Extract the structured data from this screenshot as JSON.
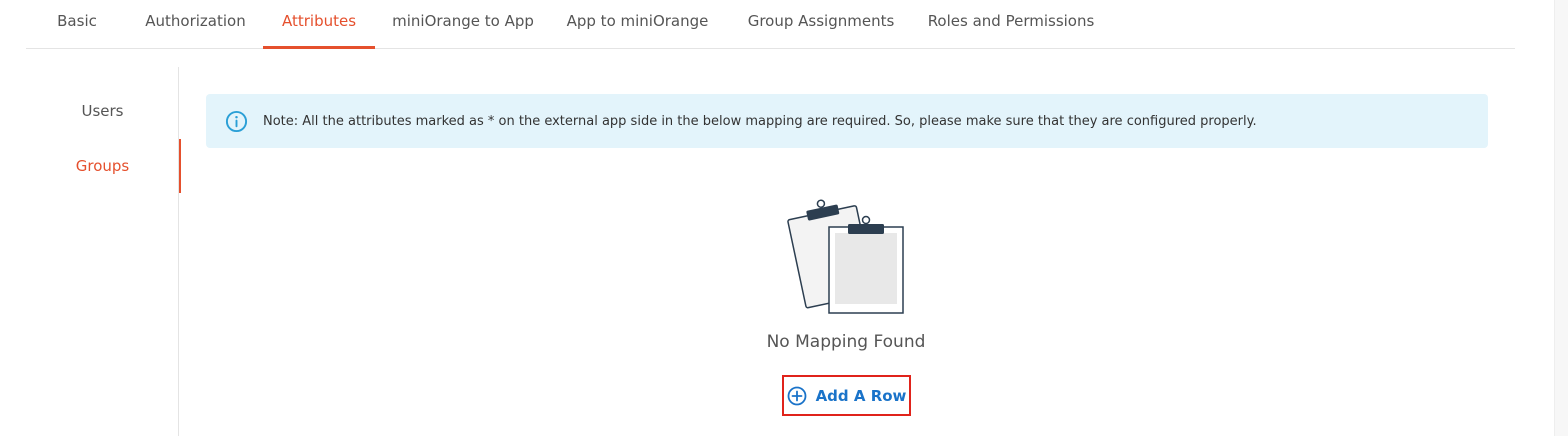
{
  "tabs": [
    {
      "label": "Basic"
    },
    {
      "label": "Authorization"
    },
    {
      "label": "Attributes"
    },
    {
      "label": "miniOrange to App"
    },
    {
      "label": "App to miniOrange"
    },
    {
      "label": "Group Assignments"
    },
    {
      "label": "Roles and Permissions"
    }
  ],
  "active_tab": "Attributes",
  "subnav": [
    {
      "label": "Users"
    },
    {
      "label": "Groups"
    }
  ],
  "active_subnav": "Groups",
  "note": {
    "text": "Note: All the attributes marked as * on the external app side in the below mapping are required. So, please make sure that they are configured properly.",
    "icon": "info-icon"
  },
  "empty_state": {
    "icon": "clipboard-icon",
    "message": "No Mapping Found",
    "button_label": "Add A Row",
    "button_icon": "plus-circle-icon"
  },
  "colors": {
    "accent": "#e5502d",
    "link": "#1a73c9",
    "note_bg": "#e3f4fb",
    "highlight_border": "#e0231b"
  }
}
